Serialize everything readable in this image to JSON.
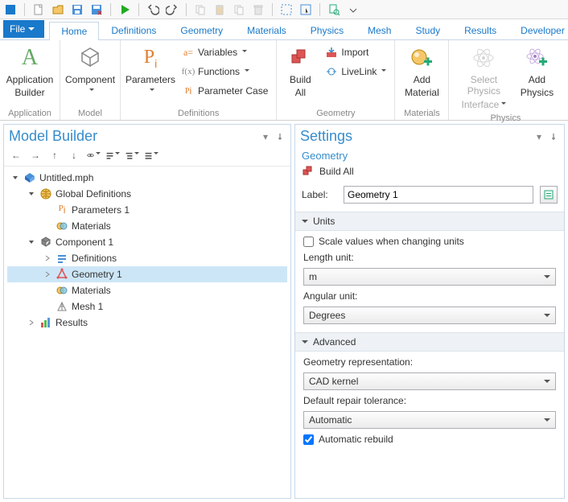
{
  "qat": {
    "dropdown": ""
  },
  "file_menu": "File",
  "tabs": [
    "Home",
    "Definitions",
    "Geometry",
    "Materials",
    "Physics",
    "Mesh",
    "Study",
    "Results",
    "Developer"
  ],
  "active_tab": 0,
  "ribbon": {
    "groups": [
      {
        "label": "Application",
        "big": [
          {
            "key": "app_builder",
            "line1": "Application",
            "line2": "Builder",
            "icon": "A",
            "drop": false
          }
        ]
      },
      {
        "label": "Model",
        "big": [
          {
            "key": "component",
            "line1": "Component",
            "line2": "",
            "icon": "component",
            "drop": true
          }
        ]
      },
      {
        "label": "Definitions",
        "big": [
          {
            "key": "parameters",
            "line1": "Parameters",
            "line2": "",
            "icon": "Pi",
            "drop": true
          }
        ],
        "small": [
          {
            "key": "variables",
            "label": "Variables",
            "icon": "a=",
            "drop": true
          },
          {
            "key": "functions",
            "label": "Functions",
            "icon": "f(x)",
            "drop": true
          },
          {
            "key": "param_case",
            "label": "Parameter Case",
            "icon": "Pi",
            "drop": false
          }
        ]
      },
      {
        "label": "Geometry",
        "big": [
          {
            "key": "build_all",
            "line1": "Build",
            "line2": "All",
            "icon": "build",
            "drop": false
          }
        ],
        "small": [
          {
            "key": "import",
            "label": "Import",
            "icon": "import",
            "drop": false
          },
          {
            "key": "livelink",
            "label": "LiveLink",
            "icon": "livelink",
            "drop": true
          }
        ]
      },
      {
        "label": "Materials",
        "big": [
          {
            "key": "add_material",
            "line1": "Add",
            "line2": "Material",
            "icon": "material",
            "drop": false
          }
        ]
      },
      {
        "label": "Physics",
        "big": [
          {
            "key": "select_physics",
            "line1": "Select Physics",
            "line2": "Interface",
            "icon": "atom",
            "drop": true,
            "disabled": true
          },
          {
            "key": "add_physics",
            "line1": "Add",
            "line2": "Physics",
            "icon": "atom_add",
            "drop": false
          }
        ]
      }
    ]
  },
  "model_builder": {
    "title": "Model Builder",
    "tree": [
      {
        "depth": 0,
        "expander": "down",
        "icon": "root",
        "label": "Untitled.mph"
      },
      {
        "depth": 1,
        "expander": "down",
        "icon": "globe",
        "label": "Global Definitions"
      },
      {
        "depth": 2,
        "expander": "",
        "icon": "pi",
        "label": "Parameters 1"
      },
      {
        "depth": 2,
        "expander": "",
        "icon": "mat",
        "label": "Materials"
      },
      {
        "depth": 1,
        "expander": "down",
        "icon": "comp",
        "label": "Component 1"
      },
      {
        "depth": 2,
        "expander": "right",
        "icon": "def",
        "label": "Definitions"
      },
      {
        "depth": 2,
        "expander": "right",
        "icon": "geom",
        "label": "Geometry 1",
        "selected": true
      },
      {
        "depth": 2,
        "expander": "",
        "icon": "mat",
        "label": "Materials"
      },
      {
        "depth": 2,
        "expander": "",
        "icon": "mesh",
        "label": "Mesh 1"
      },
      {
        "depth": 1,
        "expander": "right",
        "icon": "results",
        "label": "Results"
      }
    ]
  },
  "settings": {
    "title": "Settings",
    "subtitle": "Geometry",
    "build_all": "Build All",
    "label_caption": "Label:",
    "label_value": "Geometry 1",
    "units": {
      "head": "Units",
      "scale_label": "Scale values when changing units",
      "scale_checked": false,
      "length_label": "Length unit:",
      "length_value": "m",
      "angular_label": "Angular unit:",
      "angular_value": "Degrees"
    },
    "advanced": {
      "head": "Advanced",
      "repr_label": "Geometry representation:",
      "repr_value": "CAD kernel",
      "tol_label": "Default repair tolerance:",
      "tol_value": "Automatic",
      "auto_rebuild_label": "Automatic rebuild",
      "auto_rebuild_checked": true
    }
  }
}
